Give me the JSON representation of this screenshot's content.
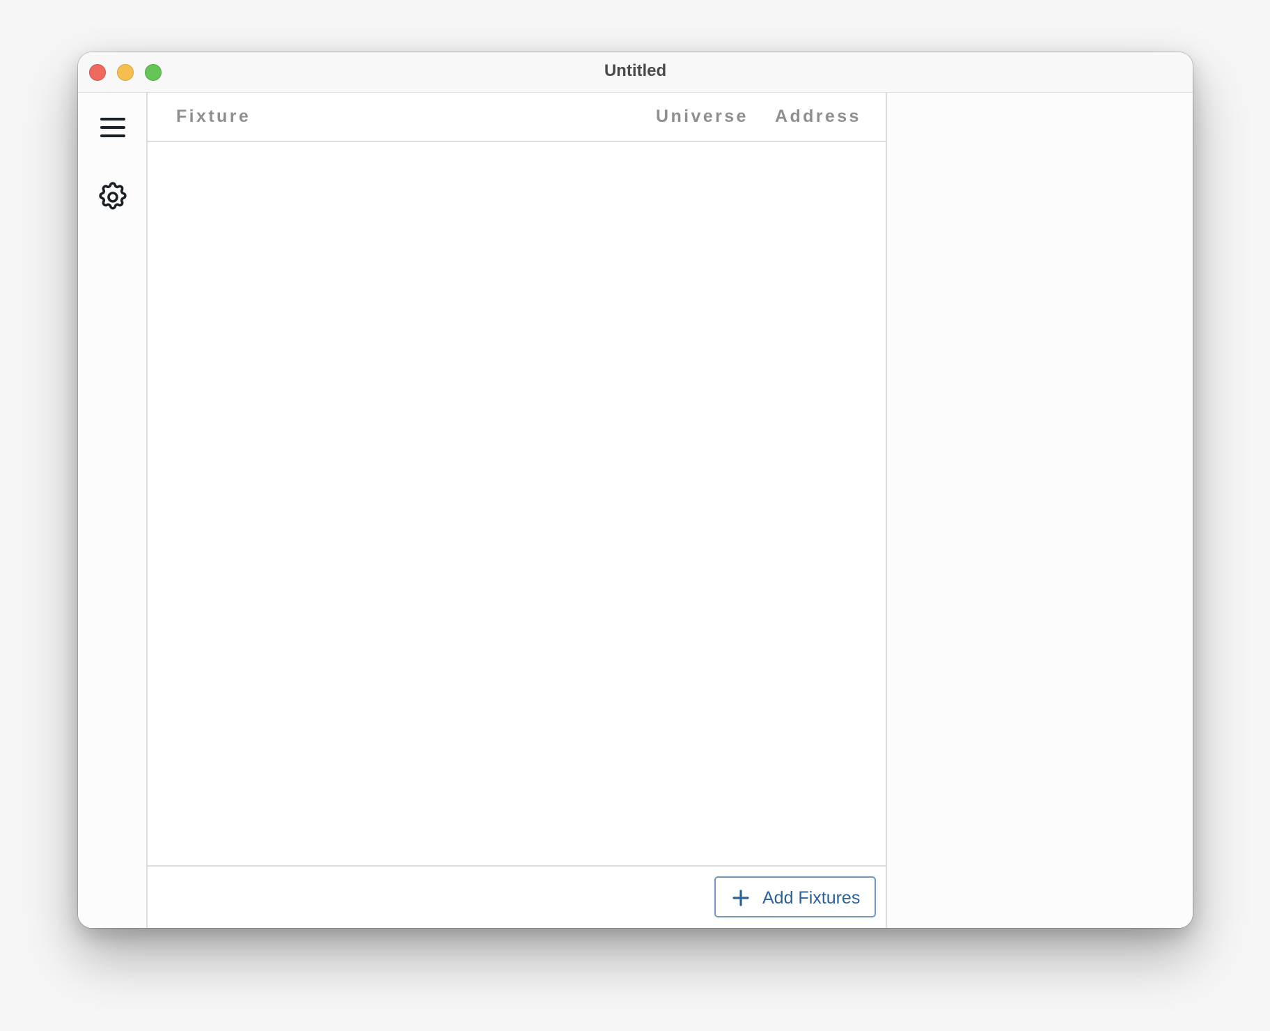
{
  "window": {
    "title": "Untitled",
    "controls": [
      "close",
      "minimize",
      "zoom"
    ]
  },
  "sidebar": {
    "items": [
      {
        "icon": "hamburger-menu-icon",
        "label": "Menu"
      },
      {
        "icon": "gear-icon",
        "label": "Settings"
      }
    ]
  },
  "table": {
    "columns": [
      "Fixture",
      "Universe",
      "Address"
    ],
    "rows": []
  },
  "footer": {
    "add_button_label": "Add Fixtures",
    "add_button_icon": "plus-icon"
  },
  "colors": {
    "accent": "#2e6197",
    "button_border": "#7398bd",
    "header_text": "#8f8f8f",
    "close": "#ee6a5f",
    "minimize": "#f5be4f",
    "zoom": "#62c554"
  }
}
